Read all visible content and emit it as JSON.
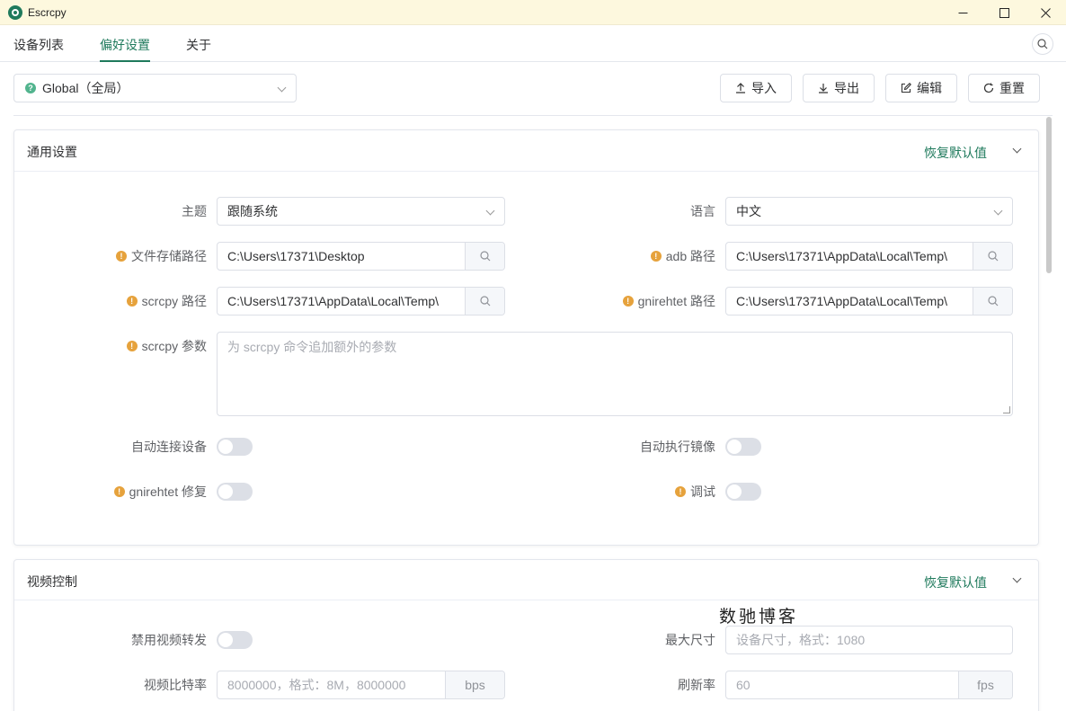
{
  "window": {
    "title": "Escrcpy",
    "controls": [
      "—",
      "□",
      "✕"
    ]
  },
  "tabs": [
    {
      "label": "设备列表"
    },
    {
      "label": "偏好设置"
    },
    {
      "label": "关于"
    }
  ],
  "toolbar": {
    "scope_value": "Global（全局）",
    "import_label": "导入",
    "export_label": "导出",
    "edit_label": "编辑",
    "reset_label": "重置"
  },
  "general": {
    "title": "通用设置",
    "restore_label": "恢复默认值",
    "theme": {
      "label": "主题",
      "value": "跟随系统"
    },
    "language": {
      "label": "语言",
      "value": "中文"
    },
    "file_path": {
      "label": "文件存储路径",
      "value": "C:\\Users\\17371\\Desktop"
    },
    "adb_path": {
      "label": "adb 路径",
      "value": "C:\\Users\\17371\\AppData\\Local\\Temp\\"
    },
    "scrcpy_path": {
      "label": "scrcpy 路径",
      "value": "C:\\Users\\17371\\AppData\\Local\\Temp\\"
    },
    "gnirehtet_path": {
      "label": "gnirehtet 路径",
      "value": "C:\\Users\\17371\\AppData\\Local\\Temp\\"
    },
    "scrcpy_args": {
      "label": "scrcpy 参数",
      "placeholder": "为 scrcpy 命令追加额外的参数"
    },
    "auto_connect": {
      "label": "自动连接设备",
      "on": false
    },
    "auto_mirror": {
      "label": "自动执行镜像",
      "on": false
    },
    "gnirehtet_fix": {
      "label": "gnirehtet 修复",
      "on": false
    },
    "debug": {
      "label": "调试",
      "on": false
    }
  },
  "video": {
    "title": "视频控制",
    "restore_label": "恢复默认值",
    "disable_forward": {
      "label": "禁用视频转发",
      "on": false
    },
    "max_size": {
      "label": "最大尺寸",
      "placeholder": "设备尺寸，格式：1080"
    },
    "bitrate": {
      "label": "视频比特率",
      "placeholder": "8000000，格式：8M，8000000",
      "unit": "bps"
    },
    "refresh": {
      "label": "刷新率",
      "placeholder": "60",
      "unit": "fps"
    }
  },
  "watermark": "数驰博客",
  "colors": {
    "accent": "#1f7a5c",
    "titlebar": "#fdf8de",
    "warning": "#e6a23c"
  }
}
